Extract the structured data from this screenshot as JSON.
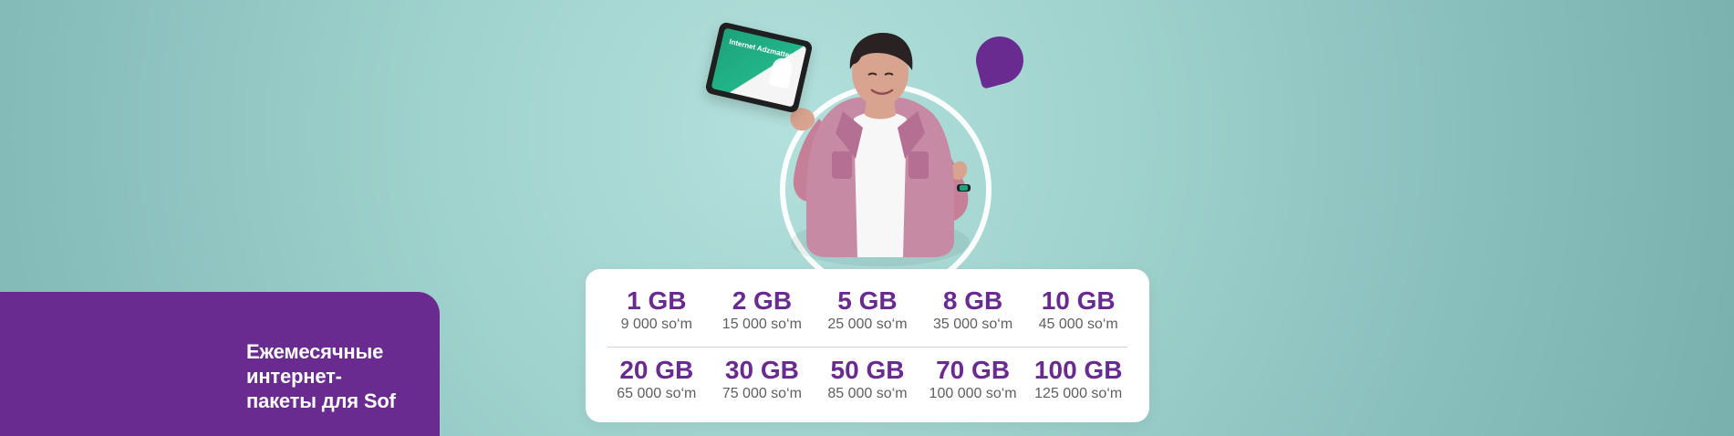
{
  "headline": {
    "line_1": "Ежемесячные",
    "line_2": "интернет-",
    "line_3": "пакеты для Sof"
  },
  "tablet": {
    "text": "Internet Adzmatter"
  },
  "packages": {
    "row_1": [
      {
        "gb": "1 GB",
        "price": "9 000 so‘m"
      },
      {
        "gb": "2 GB",
        "price": "15 000 so‘m"
      },
      {
        "gb": "5 GB",
        "price": "25 000 so‘m"
      },
      {
        "gb": "8 GB",
        "price": "35 000 so‘m"
      },
      {
        "gb": "10 GB",
        "price": "45 000 so‘m"
      }
    ],
    "row_2": [
      {
        "gb": "20 GB",
        "price": "65 000 so‘m"
      },
      {
        "gb": "30 GB",
        "price": "75 000 so‘m"
      },
      {
        "gb": "50 GB",
        "price": "85 000 so‘m"
      },
      {
        "gb": "70 GB",
        "price": "100 000 so‘m"
      },
      {
        "gb": "100 GB",
        "price": "125 000 so‘m"
      }
    ]
  },
  "colors": {
    "brand_purple": "#6a2b90",
    "background_teal": "#a8d9d6",
    "card_white": "#ffffff",
    "price_text": "#5f5f5f"
  },
  "icons": {
    "person": "person-illustration",
    "tablet": "tablet-device",
    "ring": "decorative-ring",
    "dot": "decorative-dot"
  }
}
